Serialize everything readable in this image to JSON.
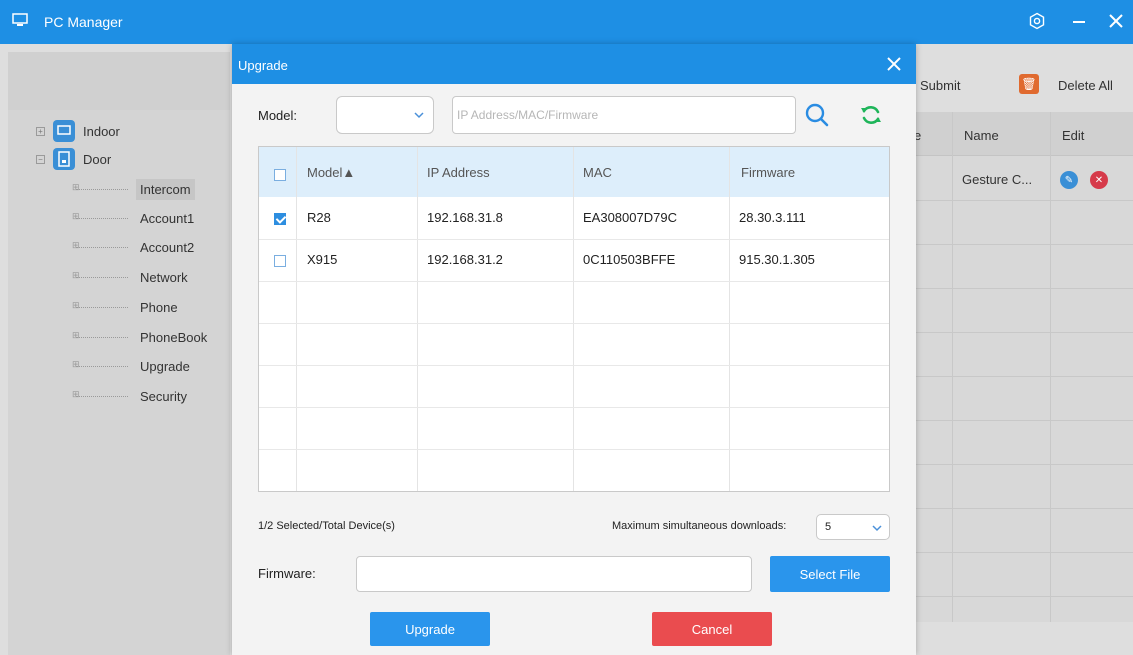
{
  "window": {
    "title": "PC Manager",
    "icons": {
      "app": "monitor-icon",
      "settings": "gear-icon",
      "minimize": "minimize-icon",
      "close": "close-icon"
    }
  },
  "tree": {
    "roots": [
      {
        "label": "Indoor",
        "icon": "indoor-monitor-icon"
      },
      {
        "label": "Door",
        "icon": "door-phone-icon"
      }
    ],
    "children": [
      "Intercom",
      "Account1",
      "Account2",
      "Network",
      "Phone",
      "PhoneBook",
      "Upgrade",
      "Security"
    ],
    "selected": "Intercom"
  },
  "background_panel": {
    "submit_label": "Submit",
    "delete_all_label": "Delete All",
    "columns": [
      "Name",
      "Edit"
    ],
    "partial_column": "e",
    "row": {
      "name": "Gesture C..."
    }
  },
  "dialog": {
    "title": "Upgrade",
    "model_label": "Model:",
    "model_value": "",
    "search_placeholder": "IP Address/MAC/Firmware",
    "columns": [
      "Model▲",
      "IP Address",
      "MAC",
      "Firmware"
    ],
    "rows": [
      {
        "checked": true,
        "model": "R28",
        "ip": "192.168.31.8",
        "mac": "EA308007D79C",
        "firmware": "28.30.3.111"
      },
      {
        "checked": false,
        "model": "X915",
        "ip": "192.168.31.2",
        "mac": "0C110503BFFE",
        "firmware": "915.30.1.305"
      }
    ],
    "count_text": "1/2  Selected/Total Device(s)",
    "max_downloads_label": "Maximum simultaneous downloads:",
    "max_downloads_value": "5",
    "firmware_label": "Firmware:",
    "firmware_value": "",
    "select_file_label": "Select File",
    "upgrade_label": "Upgrade",
    "cancel_label": "Cancel"
  },
  "colors": {
    "accent": "#1e8fe4",
    "button_blue": "#2a95ec",
    "button_red": "#ea4c4f",
    "table_header": "#ddeefb",
    "search_icon": "#2a8ce2",
    "refresh_icon": "#1fb55a"
  }
}
